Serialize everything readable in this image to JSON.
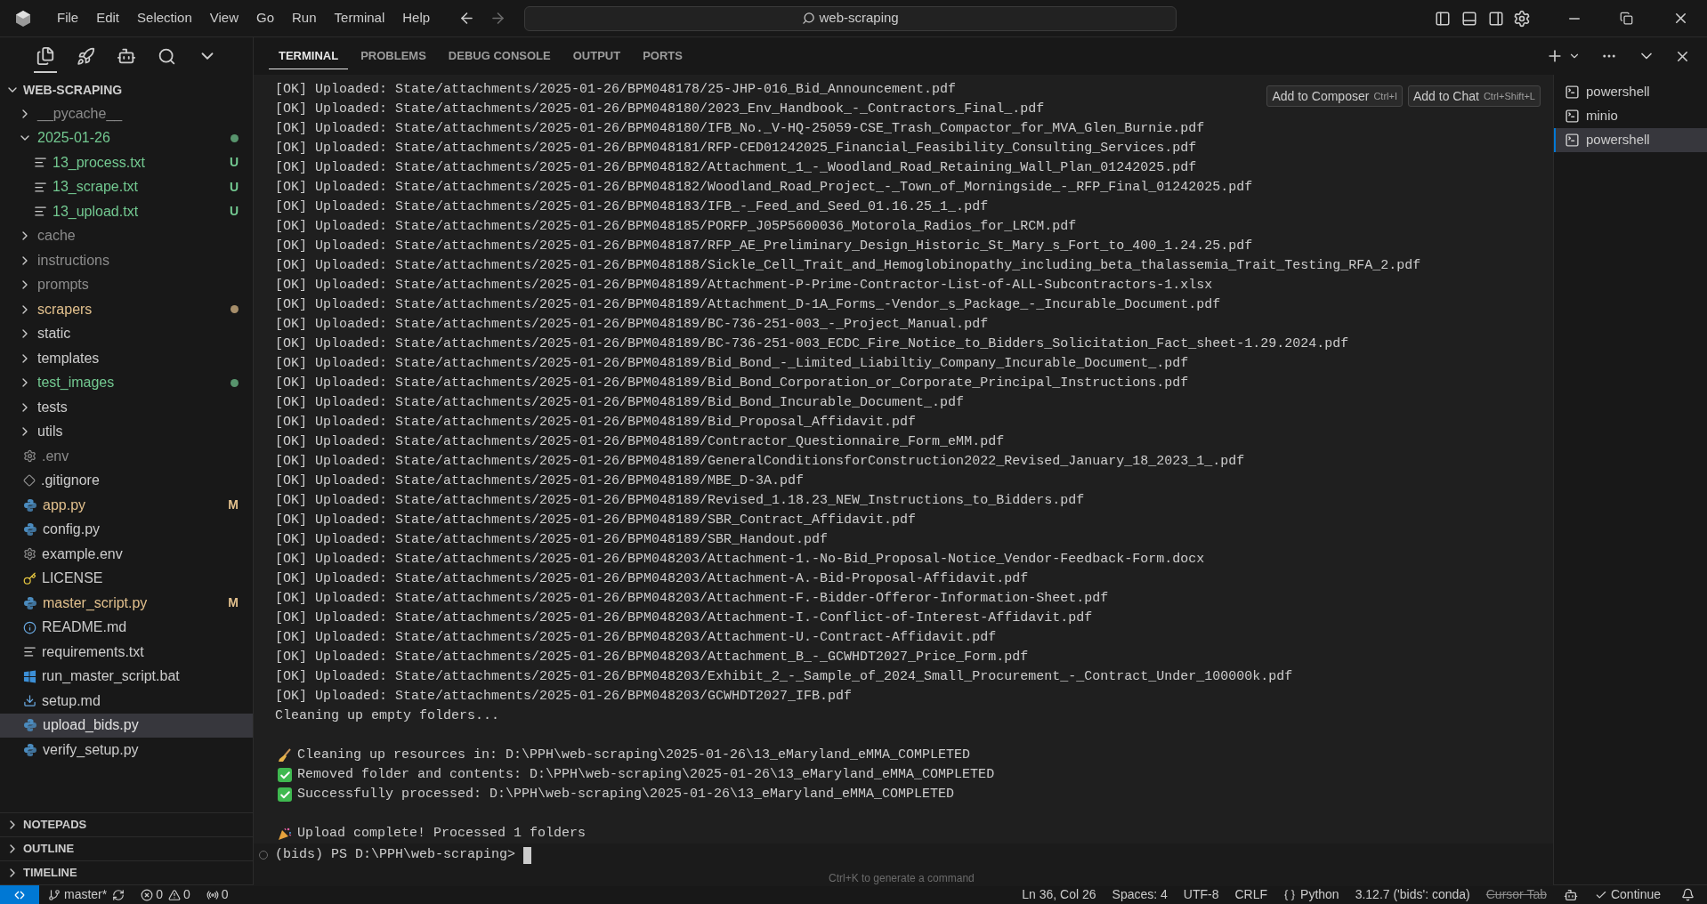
{
  "menu": [
    "File",
    "Edit",
    "Selection",
    "View",
    "Go",
    "Run",
    "Terminal",
    "Help"
  ],
  "search": {
    "value": "web-scraping"
  },
  "activity": [
    {
      "kind": "files",
      "selected": true
    },
    {
      "kind": "rocket",
      "selected": false
    },
    {
      "kind": "bot",
      "selected": false
    },
    {
      "kind": "search",
      "selected": false
    },
    {
      "kind": "more",
      "selected": false
    }
  ],
  "explorer": {
    "title": "WEB-SCRAPING",
    "items": [
      {
        "kind": "folder",
        "name": "__pycache__",
        "expanded": false,
        "color": "#8c8c8c",
        "selected": false
      },
      {
        "kind": "folder",
        "name": "2025-01-26",
        "expanded": true,
        "color": "#73c991",
        "dot": true,
        "selected": false,
        "children": [
          {
            "kind": "text",
            "name": "13_process.txt",
            "color": "#73c991",
            "badge": "U",
            "selected": false
          },
          {
            "kind": "text",
            "name": "13_scrape.txt",
            "color": "#73c991",
            "badge": "U",
            "selected": false
          },
          {
            "kind": "text",
            "name": "13_upload.txt",
            "color": "#73c991",
            "badge": "U",
            "selected": false
          }
        ]
      },
      {
        "kind": "folder",
        "name": "cache",
        "expanded": false,
        "color": "#8c8c8c",
        "selected": false
      },
      {
        "kind": "folder",
        "name": "instructions",
        "expanded": false,
        "color": "#8c8c8c",
        "selected": false
      },
      {
        "kind": "folder",
        "name": "prompts",
        "expanded": false,
        "color": "#8c8c8c",
        "selected": false
      },
      {
        "kind": "folder",
        "name": "scrapers",
        "expanded": false,
        "color": "#e2c08d",
        "dot": true,
        "selected": false
      },
      {
        "kind": "folder",
        "name": "static",
        "expanded": false,
        "color": "#cccccc",
        "selected": false
      },
      {
        "kind": "folder",
        "name": "templates",
        "expanded": false,
        "color": "#cccccc",
        "selected": false
      },
      {
        "kind": "folder",
        "name": "test_images",
        "expanded": false,
        "color": "#73c991",
        "dot": true,
        "selected": false
      },
      {
        "kind": "folder",
        "name": "tests",
        "expanded": false,
        "color": "#cccccc",
        "selected": false
      },
      {
        "kind": "folder",
        "name": "utils",
        "expanded": false,
        "color": "#cccccc",
        "selected": false
      },
      {
        "kind": "gear",
        "name": ".env",
        "color": "#8c8c8c",
        "selected": false
      },
      {
        "kind": "git",
        "name": ".gitignore",
        "color": "#cccccc",
        "selected": false
      },
      {
        "kind": "python",
        "name": "app.py",
        "color": "#e2c08d",
        "badge": "M",
        "selected": false
      },
      {
        "kind": "python",
        "name": "config.py",
        "color": "#cccccc",
        "selected": false
      },
      {
        "kind": "gear",
        "name": "example.env",
        "color": "#cccccc",
        "selected": false
      },
      {
        "kind": "license",
        "name": "LICENSE",
        "color": "#cccccc",
        "selected": false
      },
      {
        "kind": "python",
        "name": "master_script.py",
        "color": "#e2c08d",
        "badge": "M",
        "selected": false
      },
      {
        "kind": "info",
        "name": "README.md",
        "color": "#cccccc",
        "selected": false
      },
      {
        "kind": "text",
        "name": "requirements.txt",
        "color": "#cccccc",
        "selected": false
      },
      {
        "kind": "windows",
        "name": "run_master_script.bat",
        "color": "#cccccc",
        "selected": false
      },
      {
        "kind": "download",
        "name": "setup.md",
        "color": "#cccccc",
        "selected": false
      },
      {
        "kind": "python",
        "name": "upload_bids.py",
        "selected": true
      },
      {
        "kind": "python",
        "name": "verify_setup.py",
        "color": "#cccccc",
        "selected": false
      }
    ]
  },
  "sections": [
    "NOTEPADS",
    "OUTLINE",
    "TIMELINE"
  ],
  "panel_tabs": [
    {
      "label": "TERMINAL",
      "selected": true
    },
    {
      "label": "PROBLEMS",
      "selected": false
    },
    {
      "label": "DEBUG CONSOLE",
      "selected": false
    },
    {
      "label": "OUTPUT",
      "selected": false
    },
    {
      "label": "PORTS",
      "selected": false
    }
  ],
  "terminal": {
    "lines": [
      {
        "kind": "text",
        "text": "[OK] Uploaded: State/attachments/2025-01-26/BPM048178/25-JHP-016_Bid_Announcement.pdf"
      },
      {
        "kind": "text",
        "text": "[OK] Uploaded: State/attachments/2025-01-26/BPM048180/2023_Env_Handbook_-_Contractors_Final_.pdf"
      },
      {
        "kind": "text",
        "text": "[OK] Uploaded: State/attachments/2025-01-26/BPM048180/IFB_No._V-HQ-25059-CSE_Trash_Compactor_for_MVA_Glen_Burnie.pdf"
      },
      {
        "kind": "text",
        "text": "[OK] Uploaded: State/attachments/2025-01-26/BPM048181/RFP-CED01242025_Financial_Feasibility_Consulting_Services.pdf"
      },
      {
        "kind": "text",
        "text": "[OK] Uploaded: State/attachments/2025-01-26/BPM048182/Attachment_1_-_Woodland_Road_Retaining_Wall_Plan_01242025.pdf"
      },
      {
        "kind": "text",
        "text": "[OK] Uploaded: State/attachments/2025-01-26/BPM048182/Woodland_Road_Project_-_Town_of_Morningside_-_RFP_Final_01242025.pdf"
      },
      {
        "kind": "text",
        "text": "[OK] Uploaded: State/attachments/2025-01-26/BPM048183/IFB_-_Feed_and_Seed_01.16.25_1_.pdf"
      },
      {
        "kind": "text",
        "text": "[OK] Uploaded: State/attachments/2025-01-26/BPM048185/PORFP_J05P5600036_Motorola_Radios_for_LRCM.pdf"
      },
      {
        "kind": "text",
        "text": "[OK] Uploaded: State/attachments/2025-01-26/BPM048187/RFP_AE_Preliminary_Design_Historic_St_Mary_s_Fort_to_400_1.24.25.pdf"
      },
      {
        "kind": "text",
        "text": "[OK] Uploaded: State/attachments/2025-01-26/BPM048188/Sickle_Cell_Trait_and_Hemoglobinopathy_including_beta_thalassemia_Trait_Testing_RFA_2.pdf"
      },
      {
        "kind": "text",
        "text": "[OK] Uploaded: State/attachments/2025-01-26/BPM048189/Attachment-P-Prime-Contractor-List-of-ALL-Subcontractors-1.xlsx"
      },
      {
        "kind": "text",
        "text": "[OK] Uploaded: State/attachments/2025-01-26/BPM048189/Attachment_D-1A_Forms_-Vendor_s_Package_-_Incurable_Document.pdf"
      },
      {
        "kind": "text",
        "text": "[OK] Uploaded: State/attachments/2025-01-26/BPM048189/BC-736-251-003_-_Project_Manual.pdf"
      },
      {
        "kind": "text",
        "text": "[OK] Uploaded: State/attachments/2025-01-26/BPM048189/BC-736-251-003_ECDC_Fire_Notice_to_Bidders_Solicitation_Fact_sheet-1.29.2024.pdf"
      },
      {
        "kind": "text",
        "text": "[OK] Uploaded: State/attachments/2025-01-26/BPM048189/Bid_Bond_-_Limited_Liabiltiy_Company_Incurable_Document_.pdf"
      },
      {
        "kind": "text",
        "text": "[OK] Uploaded: State/attachments/2025-01-26/BPM048189/Bid_Bond_Corporation_or_Corporate_Principal_Instructions.pdf"
      },
      {
        "kind": "text",
        "text": "[OK] Uploaded: State/attachments/2025-01-26/BPM048189/Bid_Bond_Incurable_Document_.pdf"
      },
      {
        "kind": "text",
        "text": "[OK] Uploaded: State/attachments/2025-01-26/BPM048189/Bid_Proposal_Affidavit.pdf"
      },
      {
        "kind": "text",
        "text": "[OK] Uploaded: State/attachments/2025-01-26/BPM048189/Contractor_Questionnaire_Form_eMM.pdf"
      },
      {
        "kind": "text",
        "text": "[OK] Uploaded: State/attachments/2025-01-26/BPM048189/GeneralConditionsforConstruction2022_Revised_January_18_2023_1_.pdf"
      },
      {
        "kind": "text",
        "text": "[OK] Uploaded: State/attachments/2025-01-26/BPM048189/MBE_D-3A.pdf"
      },
      {
        "kind": "text",
        "text": "[OK] Uploaded: State/attachments/2025-01-26/BPM048189/Revised_1.18.23_NEW_Instructions_to_Bidders.pdf"
      },
      {
        "kind": "text",
        "text": "[OK] Uploaded: State/attachments/2025-01-26/BPM048189/SBR_Contract_Affidavit.pdf"
      },
      {
        "kind": "text",
        "text": "[OK] Uploaded: State/attachments/2025-01-26/BPM048189/SBR_Handout.pdf"
      },
      {
        "kind": "text",
        "text": "[OK] Uploaded: State/attachments/2025-01-26/BPM048203/Attachment-1.-No-Bid_Proposal-Notice_Vendor-Feedback-Form.docx"
      },
      {
        "kind": "text",
        "text": "[OK] Uploaded: State/attachments/2025-01-26/BPM048203/Attachment-A.-Bid-Proposal-Affidavit.pdf"
      },
      {
        "kind": "text",
        "text": "[OK] Uploaded: State/attachments/2025-01-26/BPM048203/Attachment-F.-Bidder-Offeror-Information-Sheet.pdf"
      },
      {
        "kind": "text",
        "text": "[OK] Uploaded: State/attachments/2025-01-26/BPM048203/Attachment-I.-Conflict-of-Interest-Affidavit.pdf"
      },
      {
        "kind": "text",
        "text": "[OK] Uploaded: State/attachments/2025-01-26/BPM048203/Attachment-U.-Contract-Affidavit.pdf"
      },
      {
        "kind": "text",
        "text": "[OK] Uploaded: State/attachments/2025-01-26/BPM048203/Attachment_B_-_GCWHDT2027_Price_Form.pdf"
      },
      {
        "kind": "text",
        "text": "[OK] Uploaded: State/attachments/2025-01-26/BPM048203/Exhibit_2_-_Sample_of_2024_Small_Procurement_-_Contract_Under_100000k.pdf"
      },
      {
        "kind": "text",
        "text": "[OK] Uploaded: State/attachments/2025-01-26/BPM048203/GCWHDT2027_IFB.pdf"
      },
      {
        "kind": "text",
        "text": "Cleaning up empty folders..."
      },
      {
        "kind": "blank"
      },
      {
        "kind": "broom",
        "text": "Cleaning up resources in: D:\\PPH\\web-scraping\\2025-01-26\\13_eMaryland_eMMA_COMPLETED"
      },
      {
        "kind": "check",
        "text": "Removed folder and contents: D:\\PPH\\web-scraping\\2025-01-26\\13_eMaryland_eMMA_COMPLETED"
      },
      {
        "kind": "check",
        "text": "Successfully processed: D:\\PPH\\web-scraping\\2025-01-26\\13_eMaryland_eMMA_COMPLETED"
      },
      {
        "kind": "blank"
      },
      {
        "kind": "party",
        "text": "Upload complete! Processed 1 folders"
      }
    ],
    "prompt": "(bids) PS D:\\PPH\\web-scraping>",
    "hint": "Ctrl+K to generate a command",
    "actions": [
      {
        "label": "Add to Composer",
        "shortcut": "Ctrl+I"
      },
      {
        "label": "Add to Chat",
        "shortcut": "Ctrl+Shift+L"
      }
    ]
  },
  "terminals": [
    {
      "name": "powershell",
      "selected": false
    },
    {
      "name": "minio",
      "selected": false
    },
    {
      "name": "powershell",
      "selected": true
    }
  ],
  "status_bar": {
    "branch": "master*",
    "errors": "0",
    "warnings": "0",
    "ports": "0",
    "right": [
      {
        "kind": "text",
        "text": "Ln 36, Col 26"
      },
      {
        "kind": "text",
        "text": "Spaces: 4"
      },
      {
        "kind": "text",
        "text": "UTF-8"
      },
      {
        "kind": "text",
        "text": "CRLF"
      },
      {
        "kind": "language",
        "text": "Python"
      },
      {
        "kind": "text",
        "text": "3.12.7 ('bids': conda)"
      },
      {
        "kind": "text",
        "text": "Cursor Tab",
        "disabled": true
      },
      {
        "kind": "copilot"
      },
      {
        "kind": "continue",
        "text": "Continue"
      },
      {
        "kind": "bell"
      }
    ]
  }
}
